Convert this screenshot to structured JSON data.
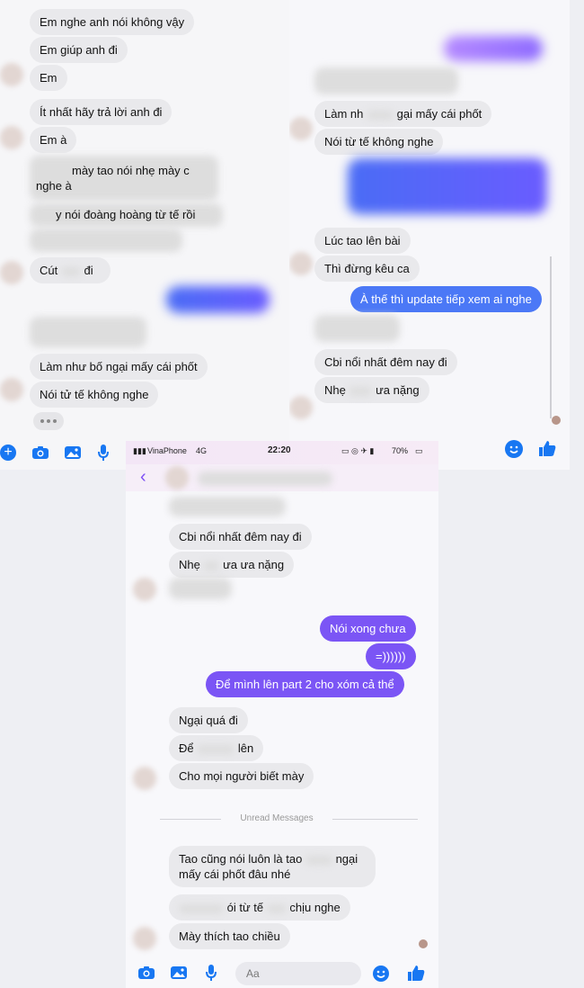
{
  "panel_left": {
    "messages": [
      "Em nghe anh nói không vậy",
      "Em giúp anh đi",
      "Em",
      "Ít nhất hãy trả lời anh đi",
      "Em à",
      "mày tao nói nhẹ mày c",
      "nghe à",
      "y nói đoàng hoàng từ tế rồi",
      "Cút",
      "đi",
      "Làm như bố ngại mấy cái phốt",
      "Nói tử tế không nghe"
    ]
  },
  "panel_right": {
    "messages": [
      "Làm nh",
      "gại mấy cái phốt",
      "Nói từ tế không nghe",
      "Lúc tao lên bài",
      "Thì đừng kêu ca",
      "À thế thì update tiếp xem ai nghe",
      "Cbi nổi nhất đêm nay đi",
      "Nhẹ",
      "ưa nặng"
    ]
  },
  "panel_phone": {
    "status": {
      "carrier": "VinaPhone",
      "network": "4G",
      "time": "22:20",
      "battery": "70%"
    },
    "messages": [
      "Cbi nổi nhất đêm nay đi",
      "Nhẹ",
      "ưa ưa nặng",
      "Nói xong chưa",
      "=))))))",
      "Để mình lên part 2 cho xóm cả thể",
      "Ngại quá đi",
      "Để",
      "lên",
      "Cho mọi người biết mày",
      "Tao cũng nói luôn là tao",
      "ngại",
      "mấy cái phốt đâu nhé",
      "ói từ tế",
      "chịu nghe",
      "Mày thích tao chiều"
    ],
    "unread_label": "Unread Messages",
    "composer_placeholder": "Aa"
  },
  "colors": {
    "outgoing": "#7b55f5",
    "incoming": "#e9e9ec",
    "messenger_blue": "#1877f2"
  }
}
